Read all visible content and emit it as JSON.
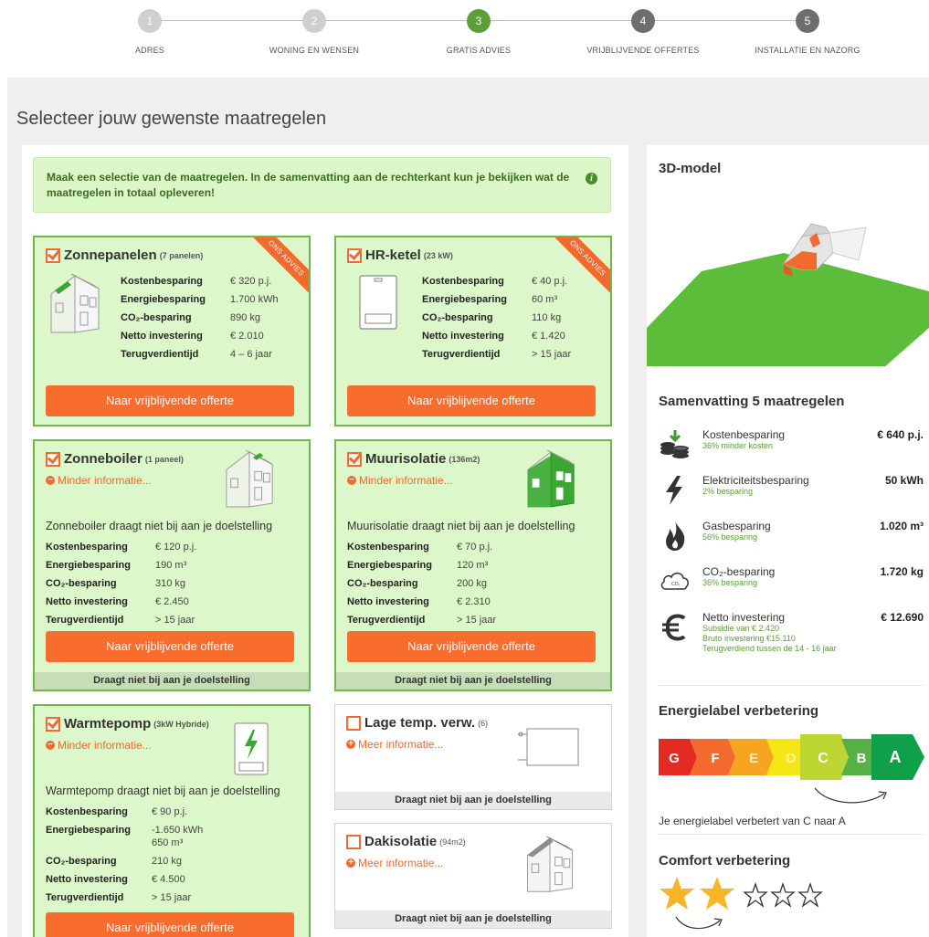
{
  "steps": [
    {
      "num": "1",
      "label": "ADRES",
      "color": "#cfcfcf"
    },
    {
      "num": "2",
      "label": "WONING EN WENSEN",
      "color": "#cfcfcf"
    },
    {
      "num": "3",
      "label": "GRATIS ADVIES",
      "color": "#5aa036"
    },
    {
      "num": "4",
      "label": "VRIJBLIJVENDE OFFERTES",
      "color": "#6e6e6e"
    },
    {
      "num": "5",
      "label": "INSTALLATIE EN NAZORG",
      "color": "#6e6e6e"
    }
  ],
  "page_title": "Selecteer jouw gewenste maatregelen",
  "info_text": "Maak een selectie van de maatregelen. In de samenvatting aan de rechterkant kun je bekijken wat de maatregelen in totaal opleveren!",
  "info_icon": "i",
  "ribbon_text": "ONS ADVIES",
  "offer_button": "Naar vrijblijvende offerte",
  "less_info": "Minder informatie...",
  "more_info": "Meer informatie...",
  "not_contributing": "Draagt niet bij aan je doelstelling",
  "stat_labels": {
    "cost": "Kostenbesparing",
    "energy": "Energiebesparing",
    "co2": "CO₂-besparing",
    "invest": "Netto investering",
    "payback": "Terugverdientijd"
  },
  "cards": {
    "zonnepanelen": {
      "title": "Zonnepanelen",
      "sub": "(7 panelen)",
      "cost": "€ 320 p.j.",
      "energy": "1.700 kWh",
      "co2": "890 kg",
      "invest": "€ 2.010",
      "payback": "4 – 6 jaar"
    },
    "hrketel": {
      "title": "HR-ketel",
      "sub": "(23 kW)",
      "cost": "€ 40 p.j.",
      "energy": "60 m³",
      "co2": "110 kg",
      "invest": "€ 1.420",
      "payback": "> 15 jaar"
    },
    "zonneboiler": {
      "title": "Zonneboiler",
      "sub": "(1 paneel)",
      "desc": "Zonneboiler draagt niet bij aan je doelstelling",
      "cost": "€ 120 p.j.",
      "energy": "190 m³",
      "co2": "310 kg",
      "invest": "€ 2.450",
      "payback": "> 15 jaar"
    },
    "muurisolatie": {
      "title": "Muurisolatie",
      "sub": "(136m2)",
      "desc": "Muurisolatie draagt niet bij aan je doelstelling",
      "cost": "€ 70 p.j.",
      "energy": "120 m³",
      "co2": "200 kg",
      "invest": "€ 2.310",
      "payback": "> 15 jaar"
    },
    "warmtepomp": {
      "title": "Warmtepomp",
      "sub": "(3kW Hybride)",
      "desc": "Warmtepomp draagt niet bij aan je doelstelling",
      "cost": "€ 90 p.j.",
      "energy": "-1.650 kWh",
      "energy2": "650 m³",
      "co2": "210 kg",
      "invest": "€ 4.500",
      "payback": "> 15 jaar"
    },
    "lagetemp": {
      "title": "Lage temp. verw.",
      "sub": "(6)"
    },
    "dakisolatie": {
      "title": "Dakisolatie",
      "sub": "(94m2)"
    }
  },
  "right": {
    "model_title": "3D-model",
    "summary_title": "Samenvatting 5 maatregelen",
    "summary": [
      {
        "label": "Kostenbesparing",
        "sub": "36% minder kosten",
        "value": "€ 640 p.j.",
        "icon": "coins-icon"
      },
      {
        "label": "Elektriciteitsbesparing",
        "sub": "2% besparing",
        "value": "50 kWh",
        "icon": "lightning-icon"
      },
      {
        "label": "Gasbesparing",
        "sub": "56% besparing",
        "value": "1.020 m³",
        "icon": "flame-icon"
      },
      {
        "label": "CO₂-besparing",
        "sub": "36% besparing",
        "value": "1.720 kg",
        "icon": "cloud-icon"
      }
    ],
    "invest": {
      "label": "Netto investering",
      "value": "€ 12.690",
      "sub1": "Subsidie van € 2.420",
      "sub2": "Bruto investering €15.110",
      "sub3": "Terugverdiend tussen de 14 - 16 jaar",
      "icon": "euro-icon"
    },
    "energylabel_title": "Energielabel verbetering",
    "labels": [
      {
        "letter": "G",
        "color": "#e52a22"
      },
      {
        "letter": "F",
        "color": "#f26a2e"
      },
      {
        "letter": "E",
        "color": "#f7a51f"
      },
      {
        "letter": "D",
        "color": "#f5e615"
      },
      {
        "letter": "C",
        "color": "#bdd631"
      },
      {
        "letter": "B",
        "color": "#57b146"
      },
      {
        "letter": "A",
        "color": "#11a04a"
      }
    ],
    "label_caption": "Je energielabel verbetert van C naar A",
    "comfort_title": "Comfort verbetering",
    "comfort_stars_filled": 2,
    "comfort_stars_total": 5
  }
}
